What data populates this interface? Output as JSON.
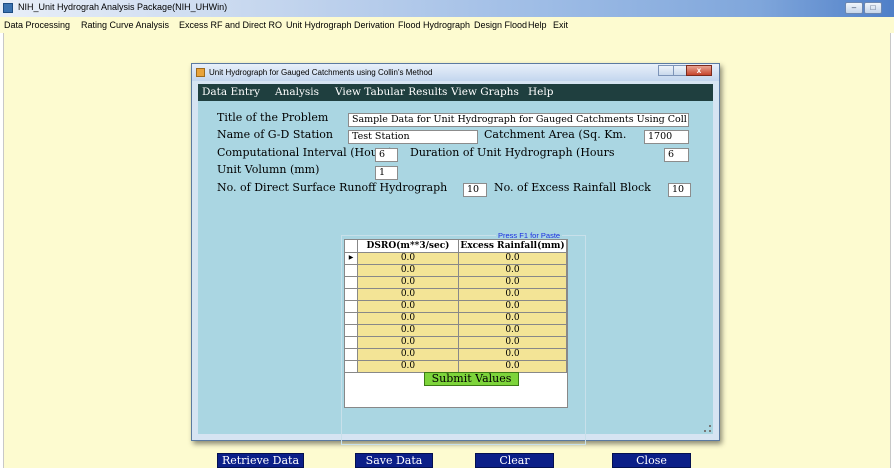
{
  "app": {
    "title": "NIH_Unit Hydrograh Analysis Package(NIH_UHWin)",
    "menu": [
      "Data Processing",
      "Rating Curve Analysis",
      "Excess RF and Direct RO",
      "Unit Hydrograph Derivation",
      "Flood Hydrograph",
      "Design Flood",
      "Help",
      "Exit"
    ]
  },
  "dialog": {
    "title": "Unit Hydrograph for Gauged Catchments using Collin's Method",
    "menu": [
      "Data Entry",
      "Analysis",
      "View Tabular Results",
      "View Graphs",
      "Help"
    ],
    "form": {
      "title_label": "Title of the Problem",
      "title_value": "Sample Data for Unit Hydrograph for Gauged Catchments Using Coll",
      "station_label": "Name of G-D Station",
      "station_value": "Test Station",
      "area_label": "Catchment Area (Sq. Km.",
      "area_value": "1700",
      "interval_label": "Computational Interval (Hours)",
      "interval_value": "6",
      "duration_label": "Duration of Unit Hydrograph (Hours",
      "duration_value": "6",
      "volume_label": "Unit Volumn (mm)",
      "volume_value": "1",
      "dsrh_label": "No. of Direct Surface Runoff Hydrograph",
      "dsrh_value": "10",
      "erb_label": "No. of Excess Rainfall Block",
      "erb_value": "10"
    },
    "grid": {
      "hint": "Press F1 for Paste",
      "columns": [
        "DSRO(m**3/sec)",
        "Excess Rainfall(mm)"
      ],
      "rows": [
        [
          "0.0",
          "0.0"
        ],
        [
          "0.0",
          "0.0"
        ],
        [
          "0.0",
          "0.0"
        ],
        [
          "0.0",
          "0.0"
        ],
        [
          "0.0",
          "0.0"
        ],
        [
          "0.0",
          "0.0"
        ],
        [
          "0.0",
          "0.0"
        ],
        [
          "0.0",
          "0.0"
        ],
        [
          "0.0",
          "0.0"
        ],
        [
          "0.0",
          "0.0"
        ]
      ],
      "row_marker": "▶"
    },
    "submit_label": "Submit Values",
    "buttons": {
      "retrieve": "Retrieve Data",
      "save": "Save Data",
      "clear": "Clear",
      "close": "Close"
    }
  }
}
